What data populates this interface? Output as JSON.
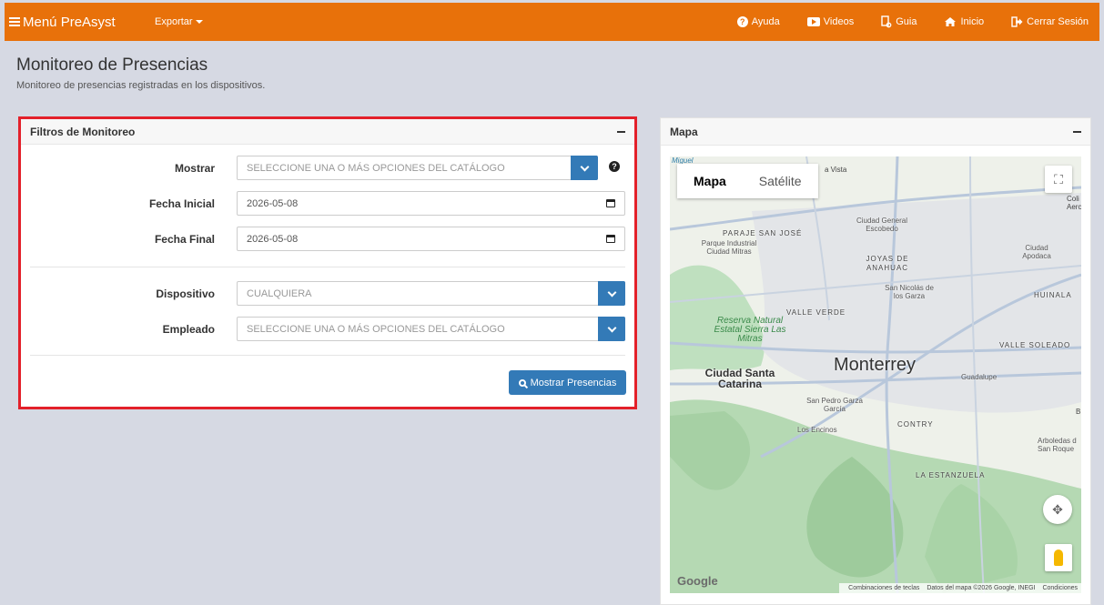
{
  "nav": {
    "brand": "Menú PreAsyst",
    "export": "Exportar",
    "help": "Ayuda",
    "videos": "Videos",
    "guide": "Guia",
    "home": "Inicio",
    "logout": "Cerrar Sesión"
  },
  "page": {
    "title": "Monitoreo de Presencias",
    "subtitle": "Monitoreo de presencias registradas en los dispositivos."
  },
  "filters": {
    "title": "Filtros de Monitoreo",
    "show_label": "Mostrar",
    "show_placeholder": "SELECCIONE UNA O MÁS OPCIONES DEL CATÁLOGO",
    "start_label": "Fecha Inicial",
    "start_value": "2026-05-08",
    "end_label": "Fecha Final",
    "end_value": "2026-05-08",
    "device_label": "Dispositivo",
    "device_value": "CUALQUIERA",
    "employee_label": "Empleado",
    "employee_placeholder": "SELECCIONE UNA O MÁS OPCIONES DEL CATÁLOGO",
    "submit": "Mostrar Presencias"
  },
  "map": {
    "title": "Mapa",
    "tab_map": "Mapa",
    "tab_satellite": "Satélite",
    "google": "Google",
    "attrib_keys": "Combinaciones de teclas",
    "attrib_data": "Datos del mapa ©2026 Google, INEGI",
    "attrib_terms": "Condiciones",
    "labels": {
      "monterrey": "Monterrey",
      "santa_catarina": "Ciudad Santa Catarina",
      "guadalupe": "Guadalupe",
      "escobedo": "Ciudad General Escobedo",
      "san_nicolas": "San Nicolás de los Garza",
      "apodaca": "Ciudad Apodaca",
      "san_pedro": "San Pedro Garza García",
      "valle_verde": "VALLE VERDE",
      "joyas": "JOYAS DE ANAHUAC",
      "contry": "CONTRY",
      "estanzuela": "LA ESTANZUELA",
      "valle_soleado": "VALLE SOLEADO",
      "huinala": "HUINALA",
      "paraje": "PARAJE SAN JOSÉ",
      "parque_industrial": "Parque Industrial Ciudad Mitras",
      "los_encinos": "Los Encinos",
      "reserva": "Reserva Natural Estatal Sierra Las Mitras",
      "miguel": "Miguel",
      "vista": "a Vista",
      "coli": "Coli Aerc",
      "arboledas": "Arboledas d San Roque",
      "b": "B"
    }
  }
}
